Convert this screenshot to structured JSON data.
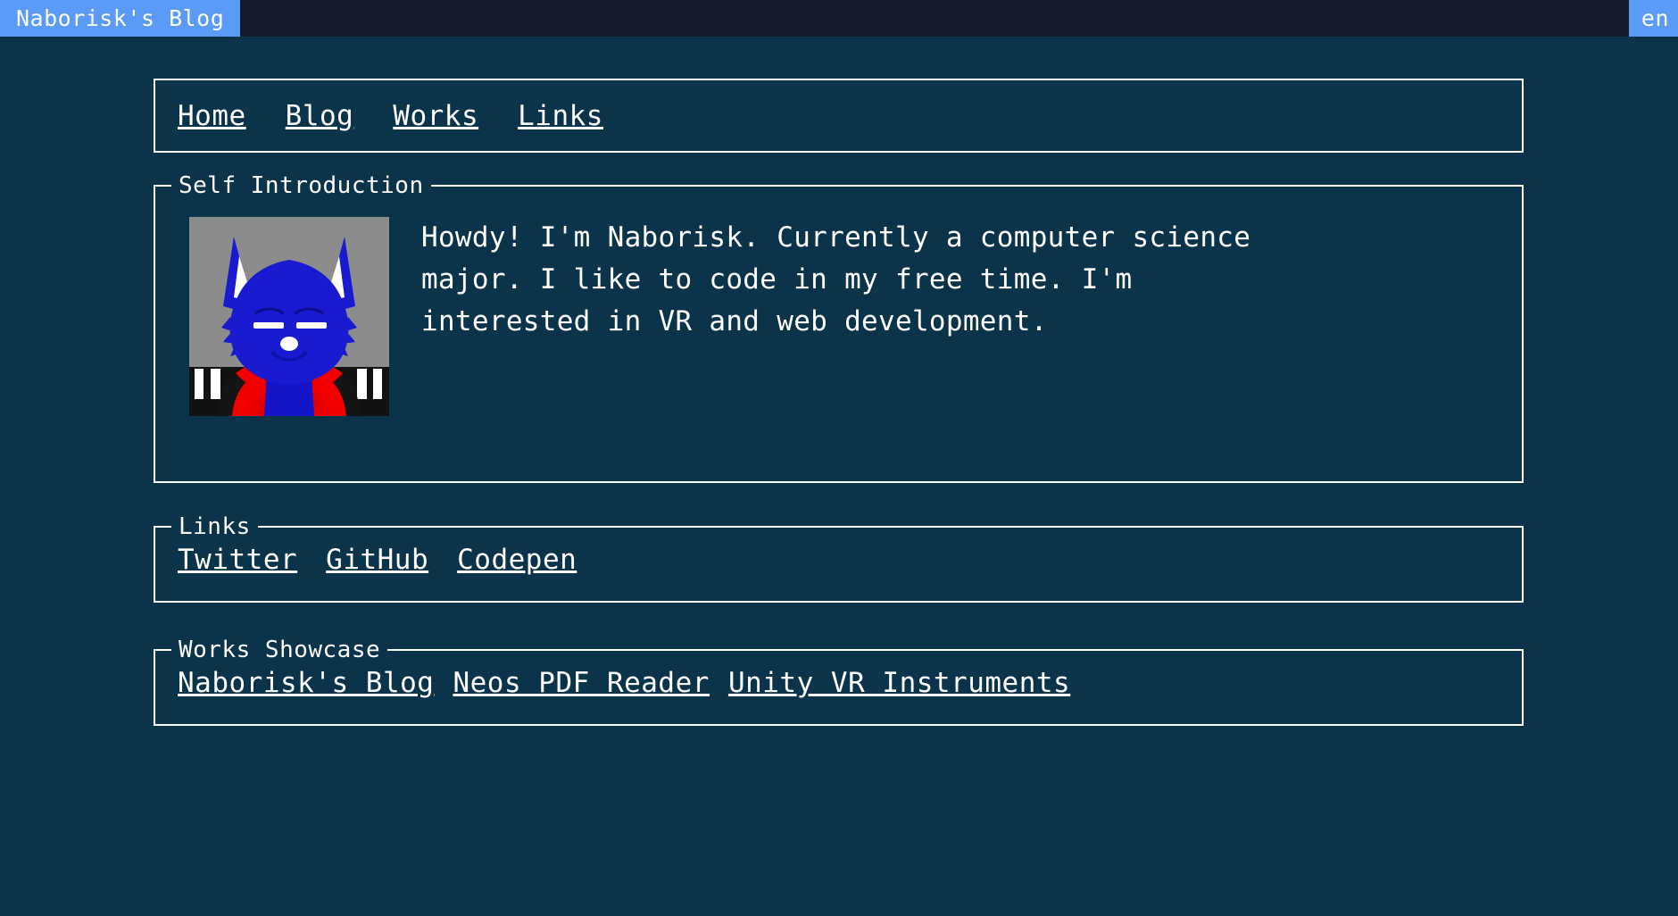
{
  "window": {
    "tab_title": "Naborisk's Blog",
    "lang_tab": "en",
    "tab_color": "#5b9bf8",
    "titlebar_color": "#141a28"
  },
  "theme": {
    "background": "#0b3349",
    "foreground": "#ffffff",
    "border": "#ffffff"
  },
  "nav": {
    "items": [
      {
        "label": "Home"
      },
      {
        "label": "Blog"
      },
      {
        "label": "Works"
      },
      {
        "label": "Links"
      }
    ]
  },
  "intro": {
    "legend": "Self Introduction",
    "avatar_alt": "avatar-blue-fox-character",
    "text": "Howdy! I'm Naborisk. Currently a computer science major. I like to code in my free time. I'm interested in VR and web development."
  },
  "links": {
    "legend": "Links",
    "items": [
      {
        "label": "Twitter"
      },
      {
        "label": "GitHub"
      },
      {
        "label": "Codepen"
      }
    ]
  },
  "works": {
    "legend": "Works Showcase",
    "items": [
      {
        "label": "Naborisk's Blog"
      },
      {
        "label": "Neos PDF Reader"
      },
      {
        "label": "Unity VR Instruments"
      }
    ]
  }
}
